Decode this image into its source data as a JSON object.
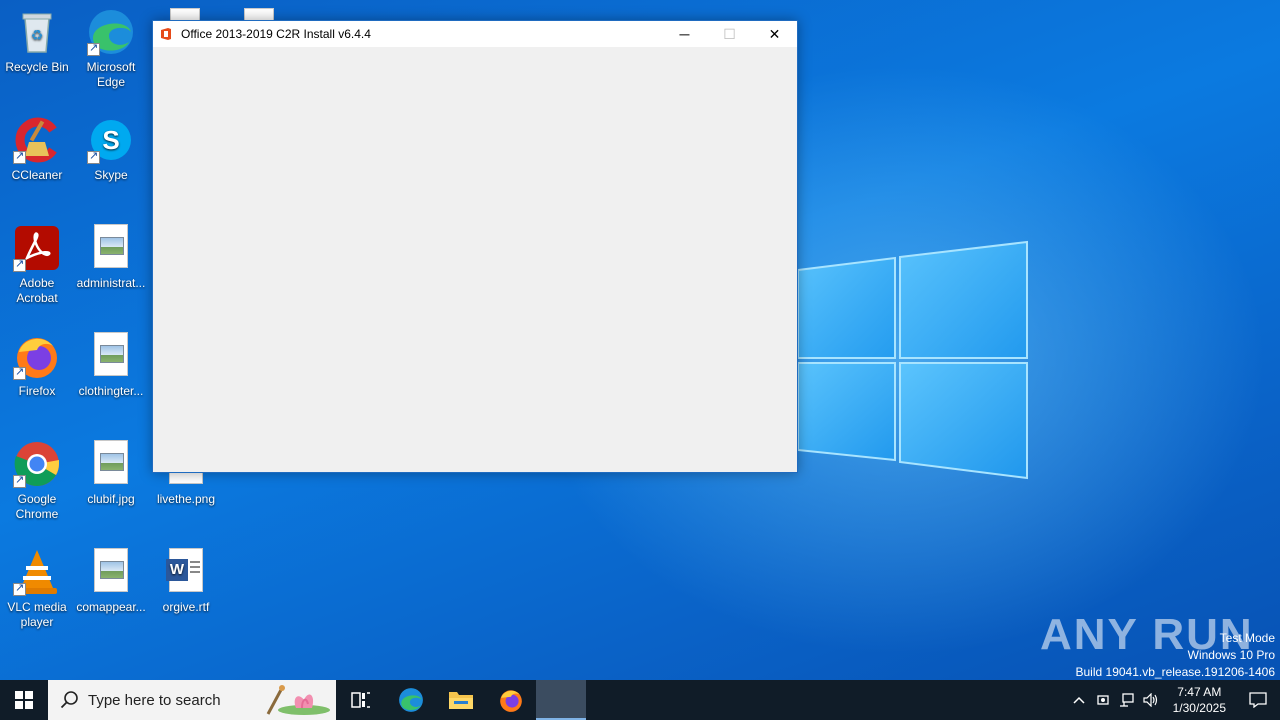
{
  "desktop": {
    "icons": [
      {
        "label": "Recycle Bin",
        "icon": "recycle-bin-icon"
      },
      {
        "label": "Microsoft Edge",
        "icon": "edge-icon"
      },
      {
        "label": "CCleaner",
        "icon": "ccleaner-icon"
      },
      {
        "label": "Skype",
        "icon": "skype-icon"
      },
      {
        "label": "Adobe Acrobat",
        "icon": "acrobat-icon"
      },
      {
        "label": "administrat...",
        "icon": "image-file-icon"
      },
      {
        "label": "Firefox",
        "icon": "firefox-icon"
      },
      {
        "label": "clothingter...",
        "icon": "image-file-icon"
      },
      {
        "label": "Google Chrome",
        "icon": "chrome-icon"
      },
      {
        "label": "clubif.jpg",
        "icon": "image-file-icon"
      },
      {
        "label": "livethe.png",
        "icon": "image-file-icon"
      },
      {
        "label": "VLC media player",
        "icon": "vlc-icon"
      },
      {
        "label": "comappear...",
        "icon": "image-file-icon"
      },
      {
        "label": "orgive.rtf",
        "icon": "word-document-icon"
      }
    ]
  },
  "window": {
    "title": "Office 2013-2019 C2R Install v6.4.4",
    "minimize": "─",
    "maximize": "☐",
    "close": "✕"
  },
  "watermark": {
    "brand": "ANY RUN",
    "line1": "Test Mode",
    "line2": "Windows 10 Pro",
    "line3": "Build 19041.vb_release.191206-1406"
  },
  "taskbar": {
    "search_placeholder": "Type here to search",
    "clock_time": "7:47 AM",
    "clock_date": "1/30/2025"
  },
  "colors": {
    "desktop_blue": "#0b7ae0",
    "taskbar": "#101c28",
    "window_body": "#f0f0f0"
  }
}
